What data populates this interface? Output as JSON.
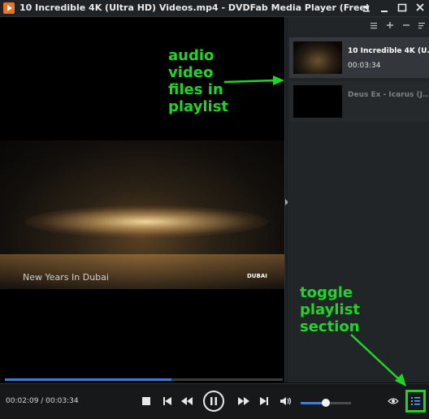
{
  "window": {
    "title": "10 Incredible 4K (Ultra HD) Videos.mp4 - DVDFab Media Player (Free)",
    "buttons": [
      "menu",
      "minimize",
      "maximize",
      "close"
    ]
  },
  "video": {
    "caption": "New Years In Dubai",
    "logo_text": "DUBAI",
    "progress_fraction": 0.6
  },
  "playlist": {
    "toolbar_icons": [
      "list-icon",
      "add-icon",
      "remove-icon",
      "sort-icon"
    ],
    "items": [
      {
        "title": "10 Incredible 4K (U...",
        "duration": "00:03:34",
        "active": true
      },
      {
        "title": "Deus Ex - Icarus (J...",
        "duration": "",
        "active": false
      }
    ]
  },
  "controls": {
    "time": "00:02:09 / 00:03:34",
    "volume_fraction": 0.5
  },
  "annotations": {
    "playlist_note": [
      "audio",
      "video",
      "files in",
      "playlist"
    ],
    "toggle_note": [
      "toggle",
      "playlist",
      "section"
    ]
  },
  "colors": {
    "accent": "#3e7fd6",
    "annotation": "#22d42a"
  }
}
